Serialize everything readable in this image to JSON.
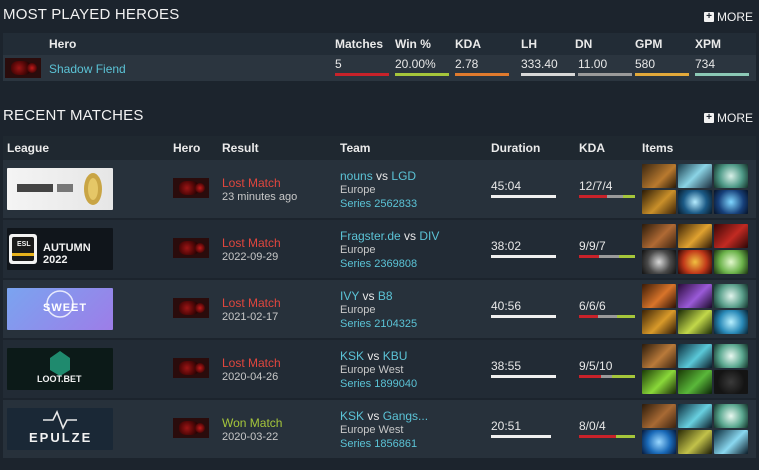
{
  "most_played": {
    "title": "MOST PLAYED HEROES",
    "more_label": "MORE",
    "columns": {
      "hero": "Hero",
      "matches": "Matches",
      "win": "Win %",
      "kda": "KDA",
      "lh": "LH",
      "dn": "DN",
      "gpm": "GPM",
      "xpm": "XPM"
    },
    "row": {
      "hero": "Shadow Fiend",
      "matches": "5",
      "win": "20.00%",
      "kda": "2.78",
      "lh": "333.40",
      "dn": "11.00",
      "gpm": "580",
      "xpm": "734"
    },
    "bar_colors": {
      "matches": "#c8222a",
      "win": "#a5c63b",
      "kda": "#e07a2d",
      "lh": "#d8d8d8",
      "dn": "#9a9a9a",
      "gpm": "#e2a93a",
      "xpm": "#8cc9b6"
    }
  },
  "recent_matches": {
    "title": "RECENT MATCHES",
    "more_label": "MORE",
    "columns": {
      "league": "League",
      "hero": "Hero",
      "result": "Result",
      "team": "Team",
      "duration": "Duration",
      "kda": "KDA",
      "items": "Items"
    },
    "vs_label": "vs",
    "rows": [
      {
        "result": "Lost Match",
        "result_color": "#e0463e",
        "date": "23 minutes ago",
        "team_a": "nouns",
        "team_b": "LGD",
        "region": "Europe",
        "series": "Series 2562833",
        "duration": "45:04",
        "kda": "12/7/4",
        "kda_parts": [
          12,
          7,
          4
        ],
        "league_name": "esports world cup"
      },
      {
        "result": "Lost Match",
        "result_color": "#e0463e",
        "date": "2022-09-29",
        "team_a": "Fragster.de",
        "team_b": "DIV",
        "region": "Europe",
        "series": "Series 2369808",
        "duration": "38:02",
        "kda": "9/9/7",
        "kda_parts": [
          9,
          9,
          7
        ],
        "league_name": "AUTUMN 2022",
        "league_prefix": "ESL"
      },
      {
        "result": "Lost Match",
        "result_color": "#e0463e",
        "date": "2021-02-17",
        "team_a": "IVY",
        "team_b": "B8",
        "region": "Europe",
        "series": "Series 2104325",
        "duration": "40:56",
        "kda": "6/6/6",
        "kda_parts": [
          6,
          6,
          6
        ],
        "league_name": "SWEET"
      },
      {
        "result": "Lost Match",
        "result_color": "#e0463e",
        "date": "2020-04-26",
        "team_a": "KSK",
        "team_b": "KBU",
        "region": "Europe West",
        "series": "Series 1899040",
        "duration": "38:55",
        "kda": "9/5/10",
        "kda_parts": [
          9,
          5,
          10
        ],
        "league_name": "LOOT.BET"
      },
      {
        "result": "Won Match",
        "result_color": "#a5c63b",
        "date": "2020-03-22",
        "team_a": "KSK",
        "team_b": "Gangs...",
        "region": "Europe West",
        "series": "Series 1856861",
        "duration": "20:51",
        "kda": "8/0/4",
        "kda_parts": [
          8,
          0,
          4
        ],
        "league_name": "EPULZE"
      }
    ]
  },
  "colors": {
    "link": "#5bc3d6",
    "loss": "#e0463e",
    "win": "#a5c63b",
    "kills": "#c8222a",
    "deaths": "#9a9a9a",
    "assists": "#a5c63b"
  }
}
